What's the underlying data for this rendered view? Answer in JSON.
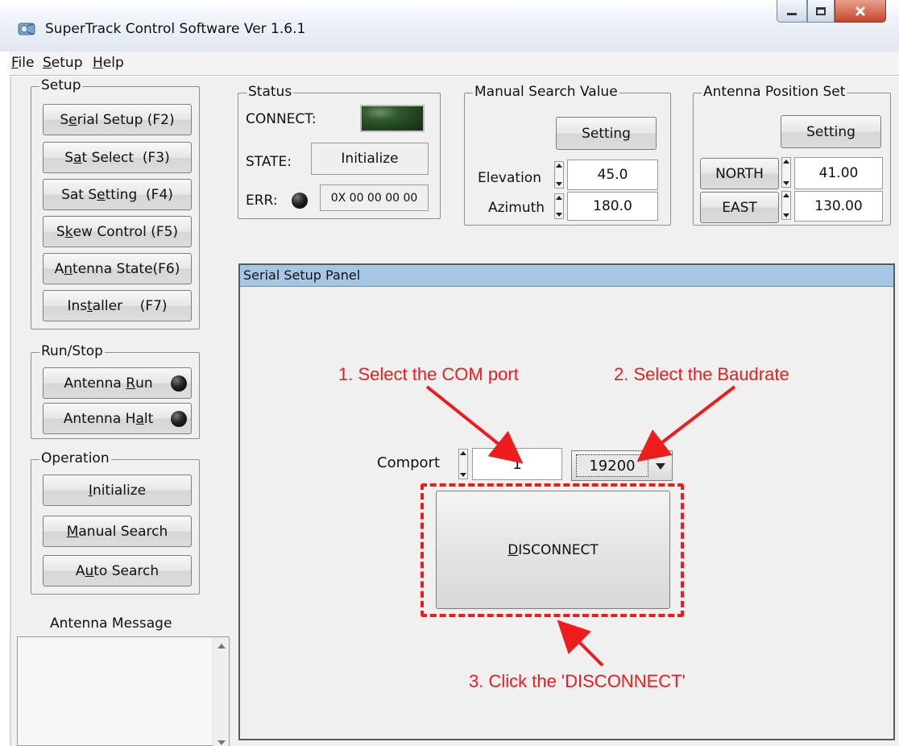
{
  "window": {
    "title": "SuperTrack Control Software Ver 1.6.1",
    "icons": {
      "app": "satellite-app-icon",
      "minimize": "minimize-icon",
      "maximize": "maximize-icon",
      "close": "close-icon"
    }
  },
  "menu": {
    "items": [
      {
        "label": "File",
        "mnemonic": "F"
      },
      {
        "label": "Setup",
        "mnemonic": "S"
      },
      {
        "label": "Help",
        "mnemonic": "H"
      }
    ]
  },
  "setup_group": {
    "label": "Setup",
    "buttons": [
      {
        "pre": "S",
        "mn": "e",
        "post": "rial Setup (F2)"
      },
      {
        "pre": "S",
        "mn": "a",
        "post": "t Select  (F3)"
      },
      {
        "pre": "Sat S",
        "mn": "e",
        "post": "tting  (F4)"
      },
      {
        "pre": "S",
        "mn": "k",
        "post": "ew Control (F5)"
      },
      {
        "pre": "A",
        "mn": "n",
        "post": "tenna State(F6)"
      },
      {
        "pre": "Ins",
        "mn": "t",
        "post": "aller    (F7)"
      }
    ]
  },
  "run_stop_group": {
    "label": "Run/Stop",
    "run": {
      "pre": "Antenna ",
      "mn": "R",
      "post": "un"
    },
    "halt": {
      "pre": "Antenna H",
      "mn": "a",
      "post": "lt"
    }
  },
  "operation_group": {
    "label": "Operation",
    "initialize": {
      "pre": "",
      "mn": "I",
      "post": "nitialize"
    },
    "manual_search": {
      "pre": "",
      "mn": "M",
      "post": "anual Search"
    },
    "auto_search": {
      "pre": "A",
      "mn": "u",
      "post": "to Search"
    }
  },
  "antenna_message": {
    "label": "Antenna Message"
  },
  "status_group": {
    "label": "Status",
    "connect_label": "CONNECT:",
    "state_label": "STATE:",
    "state_value": "Initialize",
    "err_label": "ERR:",
    "err_value": "0X 00 00 00 00"
  },
  "manual_search_group": {
    "label": "Manual Search Value",
    "setting_label": "Setting",
    "elevation_label": "Elevation",
    "elevation_value": "45.0",
    "azimuth_label": "Azimuth",
    "azimuth_value": "180.0"
  },
  "antenna_position_group": {
    "label": "Antenna Position Set",
    "setting_label": "Setting",
    "north_label": "NORTH",
    "north_value": "41.00",
    "east_label": "EAST",
    "east_value": "130.00"
  },
  "serial_panel": {
    "title": "Serial Setup Panel",
    "comport_label": "Comport",
    "comport_value": "1",
    "baudrate_value": "19200",
    "disconnect": {
      "pre": "",
      "mn": "D",
      "post": "ISCONNECT"
    }
  },
  "annotations": {
    "step1": "1. Select the COM port",
    "step2": "2. Select the Baudrate",
    "step3": "3. Click the 'DISCONNECT'",
    "color": "#ee1c1c"
  },
  "colors": {
    "panel_header": "#a7c6e6",
    "connect_indicator": "#1f3d1c",
    "close_button": "#c7432b"
  }
}
